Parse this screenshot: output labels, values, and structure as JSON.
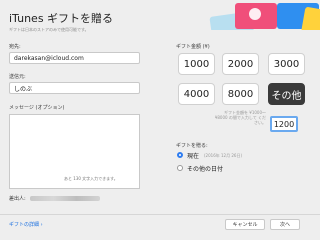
{
  "header": {
    "title": "iTunes ギフトを贈る",
    "subtitle": "ギフトは日本のストアのみで使用可能です。"
  },
  "form": {
    "recipient_label": "宛先:",
    "recipient_value": "darekasan@icloud.com",
    "sender_label": "送信元:",
    "sender_value": "しのぶ",
    "message_label": "メッセージ (オプション)",
    "char_counter": "あと 130 文字入力できます。",
    "sender_name_label": "差出人:"
  },
  "amount": {
    "label": "ギフト金額 (¥)",
    "options": [
      "1000",
      "2000",
      "3000",
      "4000",
      "8000",
      "その他"
    ],
    "selected": "その他",
    "note": "ギフト金額を ¥1000〜 ¥8000 の間で入力して ください。",
    "custom_value": "1200"
  },
  "send": {
    "label": "ギフトを贈る:",
    "now_label": "現在",
    "now_date": "(2016年 12月 26日)",
    "other_label": "その他の日付"
  },
  "footer": {
    "details_link": "ギフトの詳細",
    "cancel": "キャンセル",
    "next": "次へ"
  },
  "colors": {
    "accent": "#2d7cf0",
    "selected_button": "#3a3a3a",
    "link": "#1a6fe0"
  }
}
